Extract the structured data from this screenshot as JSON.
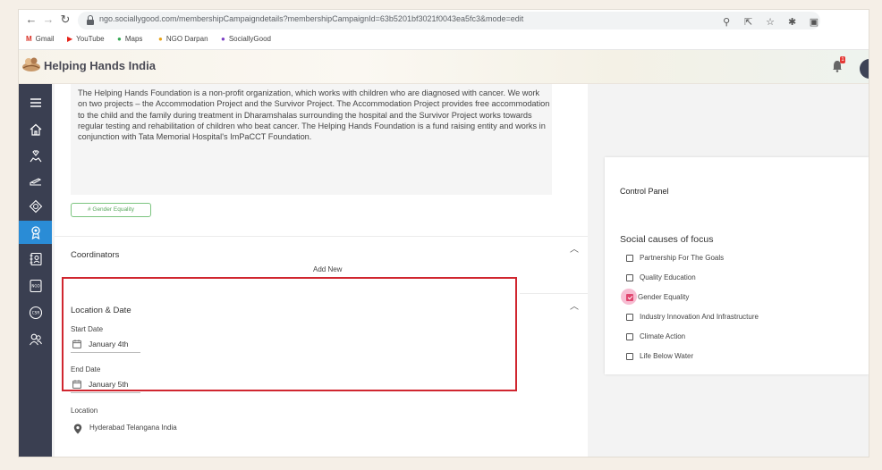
{
  "browser": {
    "url": "ngo.sociallygood.com/membershipCampaigndetails?membershipCampaignId=63b5201bf3021f0043ea5fc3&mode=edit",
    "bookmarks": [
      "Gmail",
      "YouTube",
      "Maps",
      "NGO Darpan",
      "SociallyGood"
    ]
  },
  "app": {
    "title": "Helping Hands India",
    "notification_count": "1"
  },
  "description": "The Helping Hands Foundation is a non-profit organization, which works with children who are diagnosed with cancer. We work on two projects – the Accommodation Project and the Survivor Project. The Accommodation Project provides free accommodation to the child and the family during treatment in Dharamshalas surrounding the hospital and the Survivor Project works towards regular testing and rehabilitation of children who beat cancer. The Helping Hands Foundation is a fund raising entity and works in conjunction with Tata Memorial Hospital's ImPaCCT Foundation.",
  "tag": "# Gender Equality",
  "coordinators": {
    "title": "Coordinators",
    "add_new": "Add New"
  },
  "location_date": {
    "title": "Location & Date",
    "start_label": "Start Date",
    "start_value": "January 4th",
    "end_label": "End Date",
    "end_value": "January 5th",
    "location_label": "Location",
    "location_value": "Hyderabad Telangana India"
  },
  "control_panel": {
    "title": "Control Panel",
    "subtitle": "Social causes of focus",
    "causes": [
      {
        "label": "Partnership For The Goals",
        "checked": false
      },
      {
        "label": "Quality Education",
        "checked": false
      },
      {
        "label": "Gender Equality",
        "checked": true
      },
      {
        "label": "Industry Innovation And Infrastructure",
        "checked": false
      },
      {
        "label": "Climate Action",
        "checked": false
      },
      {
        "label": "Life Below Water",
        "checked": false
      }
    ]
  },
  "colors": {
    "sidebar": "#3a3f51",
    "sidebar_active": "#2a8cd6",
    "highlight_border": "#d0262f",
    "checkbox_checked": "#e0466f",
    "tag_green": "#5aa85e"
  }
}
